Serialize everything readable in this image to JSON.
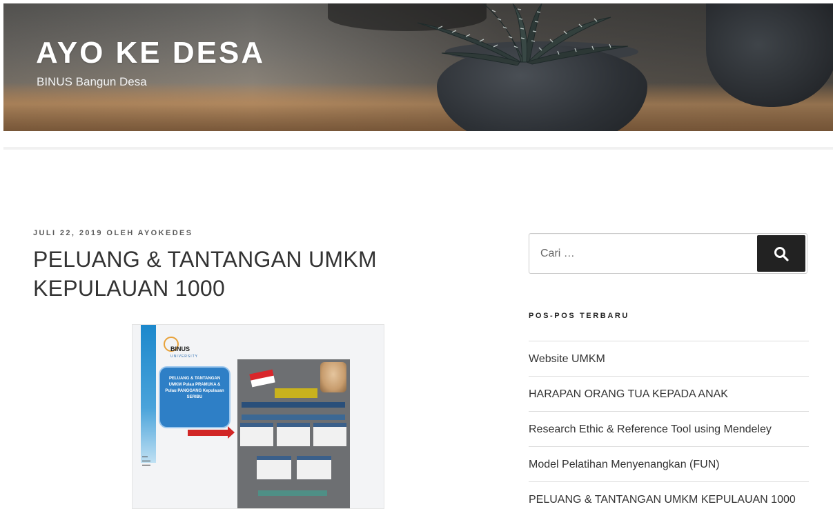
{
  "site": {
    "title": "AYO KE DESA",
    "tagline": "BINUS Bangun Desa"
  },
  "post": {
    "date": "JULI 22, 2019",
    "by": "OLEH",
    "author": "AYOKEDES",
    "title": "PELUANG & TANTANGAN UMKM KEPULAUAN 1000",
    "image": {
      "logo_text": "BINUS",
      "logo_sub": "UNIVERSITY",
      "bubble_text": "PELUANG & TANTANGAN UMKM Pulau PRAMUKA & Pulau PANGGANG Kepulauan SERIBU"
    }
  },
  "sidebar": {
    "search": {
      "placeholder": "Cari …",
      "button_icon": "search-icon"
    },
    "recent_posts": {
      "title": "POS-POS TERBARU",
      "items": [
        "Website UMKM",
        "HARAPAN ORANG TUA KEPADA ANAK",
        "Research Ethic & Reference Tool using Mendeley",
        "Model Pelatihan Menyenangkan (FUN)",
        "PELUANG & TANTANGAN UMKM KEPULAUAN 1000"
      ]
    }
  },
  "colors": {
    "button_bg": "#222222",
    "text": "#333333",
    "divider": "#dddddd"
  }
}
